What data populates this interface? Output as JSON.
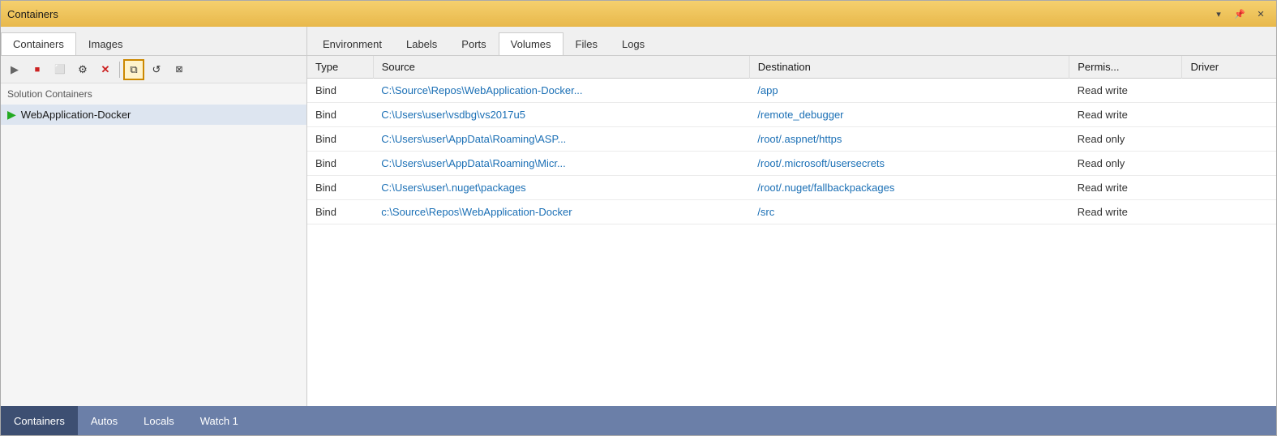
{
  "window": {
    "title": "Containers",
    "title_icon": "📦"
  },
  "title_controls": {
    "minimize": "▾",
    "pin": "📌",
    "close": "✕"
  },
  "left_panel": {
    "tabs": [
      {
        "label": "Containers",
        "active": true
      },
      {
        "label": "Images",
        "active": false
      }
    ],
    "toolbar_buttons": [
      {
        "name": "start",
        "icon": "▶",
        "title": "Start"
      },
      {
        "name": "stop",
        "icon": "■",
        "title": "Stop"
      },
      {
        "name": "terminal",
        "icon": "⬜",
        "title": "Open Terminal"
      },
      {
        "name": "settings",
        "icon": "⚙",
        "title": "Settings"
      },
      {
        "name": "delete",
        "icon": "✕",
        "title": "Delete"
      },
      {
        "name": "copy",
        "icon": "⧉",
        "title": "Copy",
        "highlighted": true
      },
      {
        "name": "refresh",
        "icon": "↺",
        "title": "Refresh"
      },
      {
        "name": "prune",
        "icon": "⊠",
        "title": "Prune"
      }
    ],
    "solution_label": "Solution Containers",
    "container_name": "WebApplication-Docker"
  },
  "right_panel": {
    "tabs": [
      {
        "label": "Environment",
        "active": false
      },
      {
        "label": "Labels",
        "active": false
      },
      {
        "label": "Ports",
        "active": false
      },
      {
        "label": "Volumes",
        "active": true
      },
      {
        "label": "Files",
        "active": false
      },
      {
        "label": "Logs",
        "active": false
      }
    ],
    "table": {
      "columns": [
        {
          "key": "type",
          "label": "Type"
        },
        {
          "key": "source",
          "label": "Source"
        },
        {
          "key": "destination",
          "label": "Destination"
        },
        {
          "key": "permissions",
          "label": "Permis..."
        },
        {
          "key": "driver",
          "label": "Driver"
        }
      ],
      "rows": [
        {
          "type": "Bind",
          "source": "C:\\Source\\Repos\\WebApplication-Docker...",
          "destination": "/app",
          "permissions": "Read write",
          "driver": ""
        },
        {
          "type": "Bind",
          "source": "C:\\Users\\user\\vsdbg\\vs2017u5",
          "destination": "/remote_debugger",
          "permissions": "Read write",
          "driver": ""
        },
        {
          "type": "Bind",
          "source": "C:\\Users\\user\\AppData\\Roaming\\ASP...",
          "destination": "/root/.aspnet/https",
          "permissions": "Read only",
          "driver": ""
        },
        {
          "type": "Bind",
          "source": "C:\\Users\\user\\AppData\\Roaming\\Micr...",
          "destination": "/root/.microsoft/usersecrets",
          "permissions": "Read only",
          "driver": ""
        },
        {
          "type": "Bind",
          "source": "C:\\Users\\user\\.nuget\\packages",
          "destination": "/root/.nuget/fallbackpackages",
          "permissions": "Read write",
          "driver": ""
        },
        {
          "type": "Bind",
          "source": "c:\\Source\\Repos\\WebApplication-Docker",
          "destination": "/src",
          "permissions": "Read write",
          "driver": ""
        }
      ]
    }
  },
  "bottom_bar": {
    "tabs": [
      {
        "label": "Containers"
      },
      {
        "label": "Autos"
      },
      {
        "label": "Locals"
      },
      {
        "label": "Watch 1"
      }
    ]
  }
}
